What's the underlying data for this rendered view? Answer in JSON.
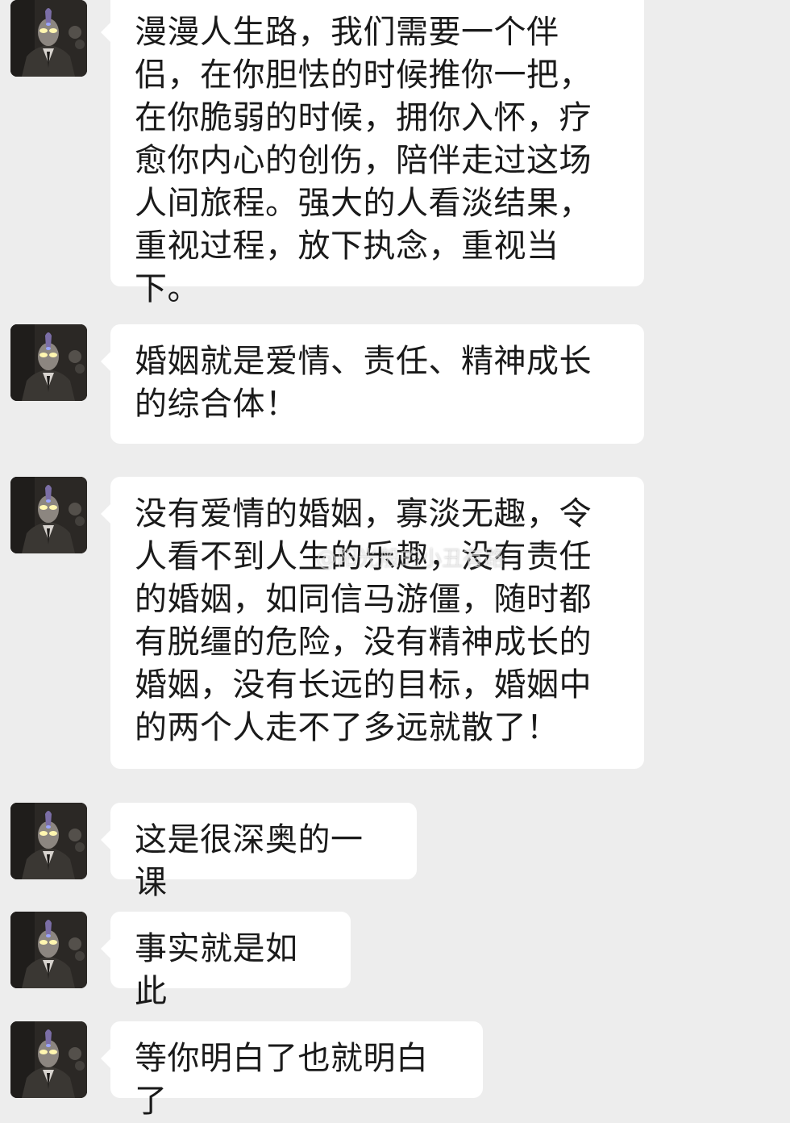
{
  "messages": [
    {
      "avatar_icon": "ultraman-suit-avatar-icon",
      "text": "漫漫人生路，我们需要一个伴侣，在你胆怯的时候推你一把，在你脆弱的时候，拥你入怀，疗愈你内心的创伤，陪伴走过这场人间旅程。强大的人看淡结果，重视过程，放下执念，重视当下。"
    },
    {
      "avatar_icon": "ultraman-suit-avatar-icon",
      "text": "婚姻就是爱情、责任、精神成长的综合体！"
    },
    {
      "avatar_icon": "ultraman-suit-avatar-icon",
      "text": "没有爱情的婚姻，寡淡无趣，令人看不到人生的乐趣，没有责任的婚姻，如同信马游僵，随时都有脱缰的危险，没有精神成长的婚姻，没有长远的目标，婚姻中的两个人走不了多远就散了！"
    },
    {
      "avatar_icon": "ultraman-suit-avatar-icon",
      "text": "这是很深奥的一课"
    },
    {
      "avatar_icon": "ultraman-suit-avatar-icon",
      "text": "事实就是如此"
    },
    {
      "avatar_icon": "ultraman-suit-avatar-icon",
      "text": "等你明白了也就明白了"
    }
  ],
  "watermark": {
    "text": "@阳光般的小丑有路"
  },
  "colors": {
    "background": "#ededed",
    "bubble": "#ffffff",
    "text": "#1a1a1a"
  }
}
